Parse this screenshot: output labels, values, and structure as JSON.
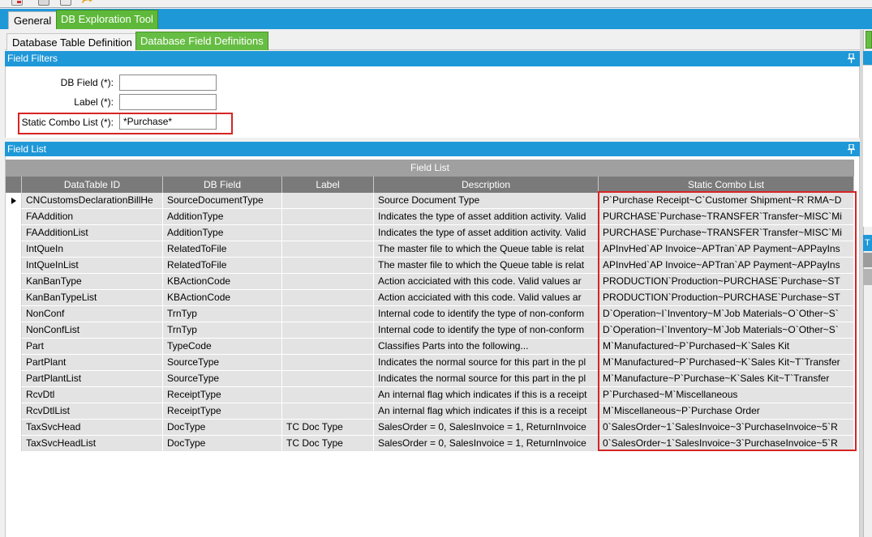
{
  "main_tabs": [
    {
      "label": "General",
      "active": false
    },
    {
      "label": "DB Exploration Tool",
      "active": true
    }
  ],
  "sub_tabs": [
    {
      "label": "Database Table Definition",
      "active": false
    },
    {
      "label": "Database Field Definitions",
      "active": true
    }
  ],
  "filters": {
    "header": "Field Filters",
    "fields": [
      {
        "label": "DB Field (*):",
        "value": ""
      },
      {
        "label": "Label (*):",
        "value": ""
      },
      {
        "label": "Static Combo List (*):",
        "value": "*Purchase*"
      }
    ]
  },
  "field_list": {
    "header": "Field List",
    "grid_title": "Field List",
    "columns": [
      "DataTable ID",
      "DB Field",
      "Label",
      "Description",
      "Static Combo List"
    ],
    "rows": [
      [
        "CNCustomsDeclarationBillHe",
        "SourceDocumentType",
        "",
        "Source Document Type",
        "P`Purchase Receipt~C`Customer Shipment~R`RMA~D"
      ],
      [
        "FAAddition",
        "AdditionType",
        "",
        "Indicates the type of asset addition activity.  Valid",
        "PURCHASE`Purchase~TRANSFER`Transfer~MISC`Mi"
      ],
      [
        "FAAdditionList",
        "AdditionType",
        "",
        "Indicates the type of asset addition activity.  Valid",
        "PURCHASE`Purchase~TRANSFER`Transfer~MISC`Mi"
      ],
      [
        "IntQueIn",
        "RelatedToFile",
        "",
        "The master file to which the Queue table is relat",
        "APInvHed`AP Invoice~APTran`AP Payment~APPayIns"
      ],
      [
        "IntQueInList",
        "RelatedToFile",
        "",
        "The master file to which the Queue table is relat",
        "APInvHed`AP Invoice~APTran`AP Payment~APPayIns"
      ],
      [
        "KanBanType",
        "KBActionCode",
        "",
        "Action acciciated with this code.  Valid values ar",
        "PRODUCTION`Production~PURCHASE`Purchase~ST"
      ],
      [
        "KanBanTypeList",
        "KBActionCode",
        "",
        "Action acciciated with this code.  Valid values ar",
        "PRODUCTION`Production~PURCHASE`Purchase~ST"
      ],
      [
        "NonConf",
        "TrnTyp",
        "",
        "Internal code to identify the type of non-conform",
        "D`Operation~I`Inventory~M`Job Materials~O`Other~S`"
      ],
      [
        "NonConfList",
        "TrnTyp",
        "",
        "Internal code to identify the type of non-conform",
        "D`Operation~I`Inventory~M`Job Materials~O`Other~S`"
      ],
      [
        "Part",
        "TypeCode",
        "",
        "Classifies Parts into the following...",
        "M`Manufactured~P`Purchased~K`Sales Kit"
      ],
      [
        "PartPlant",
        "SourceType",
        "",
        "Indicates the normal source for this part in the pl",
        "M`Manufactured~P`Purchased~K`Sales Kit~T`Transfer"
      ],
      [
        "PartPlantList",
        "SourceType",
        "",
        "Indicates the normal source for this part in the pl",
        "M`Manufacture~P`Purchase~K`Sales Kit~T`Transfer"
      ],
      [
        "RcvDtl",
        "ReceiptType",
        "",
        "An internal flag which indicates if this is a receipt",
        "P`Purchased~M`Miscellaneous"
      ],
      [
        "RcvDtlList",
        "ReceiptType",
        "",
        "An internal flag which indicates if this is a receipt",
        "M`Miscellaneous~P`Purchase Order"
      ],
      [
        "TaxSvcHead",
        "DocType",
        "TC Doc Type",
        "SalesOrder = 0, SalesInvoice = 1, ReturnInvoice",
        "0`SalesOrder~1`SalesInvoice~3`PurchaseInvoice~5`R"
      ],
      [
        "TaxSvcHeadList",
        "DocType",
        "TC Doc Type",
        "SalesOrder = 0, SalesInvoice = 1, ReturnInvoice",
        "0`SalesOrder~1`SalesInvoice~3`PurchaseInvoice~5`R"
      ]
    ]
  },
  "right_panel_header": "T",
  "colors": {
    "accent_blue": "#1f98d8",
    "active_tab_green": "#5eb83a",
    "highlight_red": "#d72424"
  }
}
